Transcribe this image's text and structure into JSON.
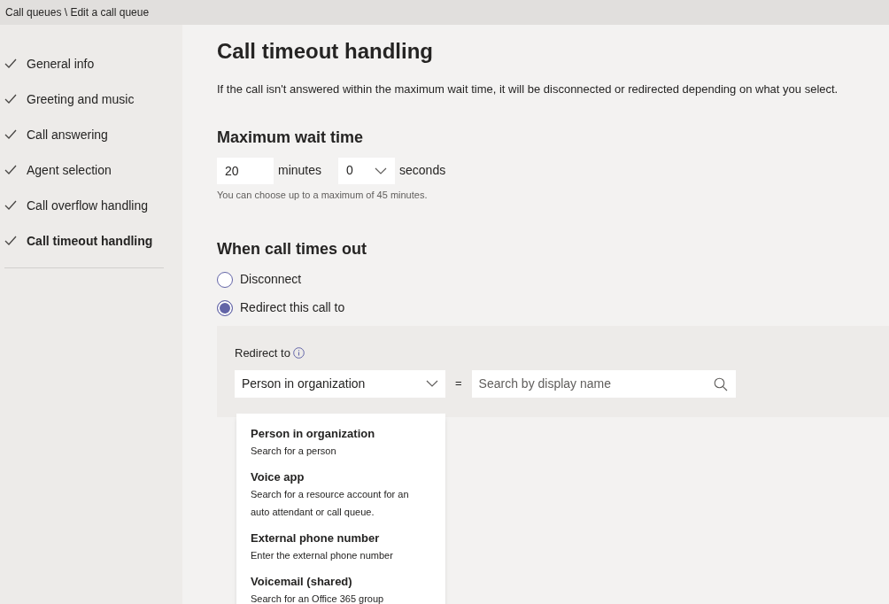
{
  "breadcrumb": "Call queues \\ Edit a call queue",
  "sidebar": {
    "items": [
      {
        "label": "General info",
        "checked": true,
        "selected": false
      },
      {
        "label": "Greeting and music",
        "checked": true,
        "selected": false
      },
      {
        "label": "Call answering",
        "checked": true,
        "selected": false
      },
      {
        "label": "Agent selection",
        "checked": true,
        "selected": false
      },
      {
        "label": "Call overflow handling",
        "checked": true,
        "selected": false
      },
      {
        "label": "Call timeout handling",
        "checked": true,
        "selected": true
      }
    ]
  },
  "title": "Call timeout handling",
  "description": "If the call isn't answered within the maximum wait time, it will be disconnected or redirected depending on what you select.",
  "max_wait": {
    "heading": "Maximum wait time",
    "minutes_value": "20",
    "minutes_label": "minutes",
    "seconds_value": "0",
    "seconds_label": "seconds",
    "hint": "You can choose up to a maximum of 45 minutes."
  },
  "timeout": {
    "heading": "When call times out",
    "options": [
      {
        "label": "Disconnect",
        "selected": false
      },
      {
        "label": "Redirect this call to",
        "selected": true
      }
    ]
  },
  "redirect": {
    "label": "Redirect to",
    "type_value": "Person in organization",
    "equals": "=",
    "search_placeholder": "Search by display name",
    "menu": [
      {
        "title": "Person in organization",
        "subtitle": "Search for a person"
      },
      {
        "title": "Voice app",
        "subtitle": "Search for a resource account for an auto attendant or call queue."
      },
      {
        "title": "External phone number",
        "subtitle": "Enter the external phone number"
      },
      {
        "title": "Voicemail (shared)",
        "subtitle": "Search for an Office 365 group"
      }
    ]
  }
}
